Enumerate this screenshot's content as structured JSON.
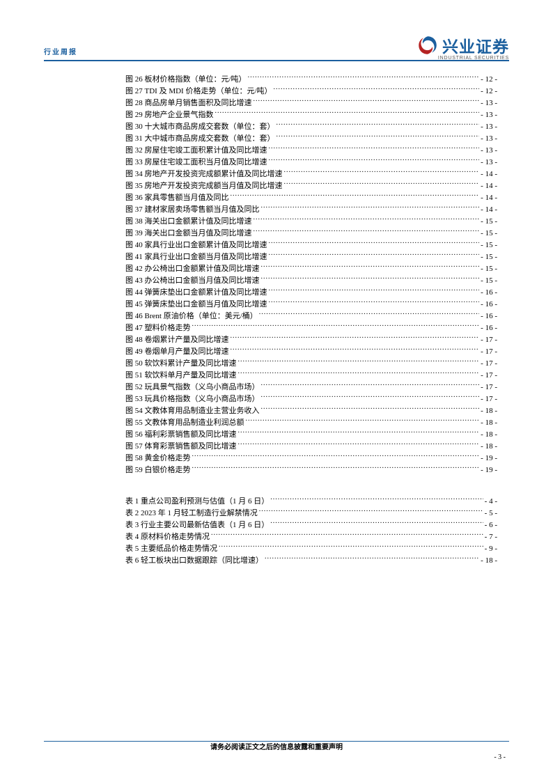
{
  "header": {
    "label": "行业周报"
  },
  "logo": {
    "cn": "兴业证券",
    "en": "INDUSTRIAL SECURITIES"
  },
  "figures": [
    {
      "label": "图 26  板材价格指数（单位：元/吨）",
      "page": "12"
    },
    {
      "label": "图 27 TDI 及 MDI 价格走势（单位：元/吨）",
      "page": "12"
    },
    {
      "label": "图 28  商品房单月销售面积及同比增速",
      "page": "13"
    },
    {
      "label": "图 29  房地产企业景气指数",
      "page": "13"
    },
    {
      "label": "图 30  十大城市商品房成交套数（单位：套）",
      "page": "13"
    },
    {
      "label": "图 31  大中城市商品房成交套数（单位：套）",
      "page": "13"
    },
    {
      "label": "图 32  房屋住宅竣工面积累计值及同比增速",
      "page": "13"
    },
    {
      "label": "图 33  房屋住宅竣工面积当月值及同比增速",
      "page": "13"
    },
    {
      "label": "图 34  房地产开发投资完成额累计值及同比增速",
      "page": "14"
    },
    {
      "label": "图 35  房地产开发投资完成额当月值及同比增速",
      "page": "14"
    },
    {
      "label": "图 36  家具零售额当月值及同比",
      "page": "14"
    },
    {
      "label": "图 37  建材家居卖场零售额当月值及同比",
      "page": "14"
    },
    {
      "label": "图 38  海关出口金额累计值及同比增速",
      "page": "15"
    },
    {
      "label": "图 39  海关出口金额当月值及同比增速",
      "page": "15"
    },
    {
      "label": "图 40  家具行业出口金额累计值及同比增速",
      "page": "15"
    },
    {
      "label": "图 41  家具行业出口金额当月值及同比增速",
      "page": "15"
    },
    {
      "label": "图 42  办公椅出口金额累计值及同比增速",
      "page": "15"
    },
    {
      "label": "图 43  办公椅出口金额当月值及同比增速",
      "page": "15"
    },
    {
      "label": "图 44  弹簧床垫出口金额累计值及同比增速",
      "page": "16"
    },
    {
      "label": "图 45  弹簧床垫出口金额当月值及同比增速",
      "page": "16"
    },
    {
      "label": "图 46 Brent 原油价格（单位：美元/桶）",
      "page": "16"
    },
    {
      "label": "图 47  塑料价格走势",
      "page": "16"
    },
    {
      "label": "图 48  卷烟累计产量及同比增速",
      "page": "17"
    },
    {
      "label": "图 49  卷烟单月产量及同比增速",
      "page": "17"
    },
    {
      "label": "图 50  软饮料累计产量及同比增速",
      "page": "17"
    },
    {
      "label": "图 51  软饮料单月产量及同比增速",
      "page": "17"
    },
    {
      "label": "图 52  玩具景气指数（义乌小商品市场）",
      "page": "17"
    },
    {
      "label": "图 53  玩具价格指数（义乌小商品市场）",
      "page": "17"
    },
    {
      "label": "图 54  文教体育用品制造业主营业务收入",
      "page": "18"
    },
    {
      "label": "图 55  文教体育用品制造业利润总额",
      "page": "18"
    },
    {
      "label": "图 56  福利彩票销售额及同比增速",
      "page": "18"
    },
    {
      "label": "图 57  体育彩票销售额及同比增速",
      "page": "18"
    },
    {
      "label": "图 58  黄金价格走势",
      "page": "19"
    },
    {
      "label": "图 59  白银价格走势",
      "page": "19"
    }
  ],
  "tables": [
    {
      "label": "表 1  重点公司盈利预测与估值（1 月 6 日）",
      "page": "4"
    },
    {
      "label": "表 2 2023 年 1 月轻工制造行业解禁情况",
      "page": "5"
    },
    {
      "label": "表 3  行业主要公司最新估值表（1 月 6 日）",
      "page": "6"
    },
    {
      "label": "表 4  原材料价格走势情况",
      "page": "7"
    },
    {
      "label": "表 5  主要纸品价格走势情况",
      "page": "9"
    },
    {
      "label": "表 6  轻工板块出口数据跟踪（同比增速）",
      "page": "18"
    }
  ],
  "footer": {
    "text": "请务必阅读正文之后的信息披露和重要声明",
    "page_num": "- 3 -"
  }
}
